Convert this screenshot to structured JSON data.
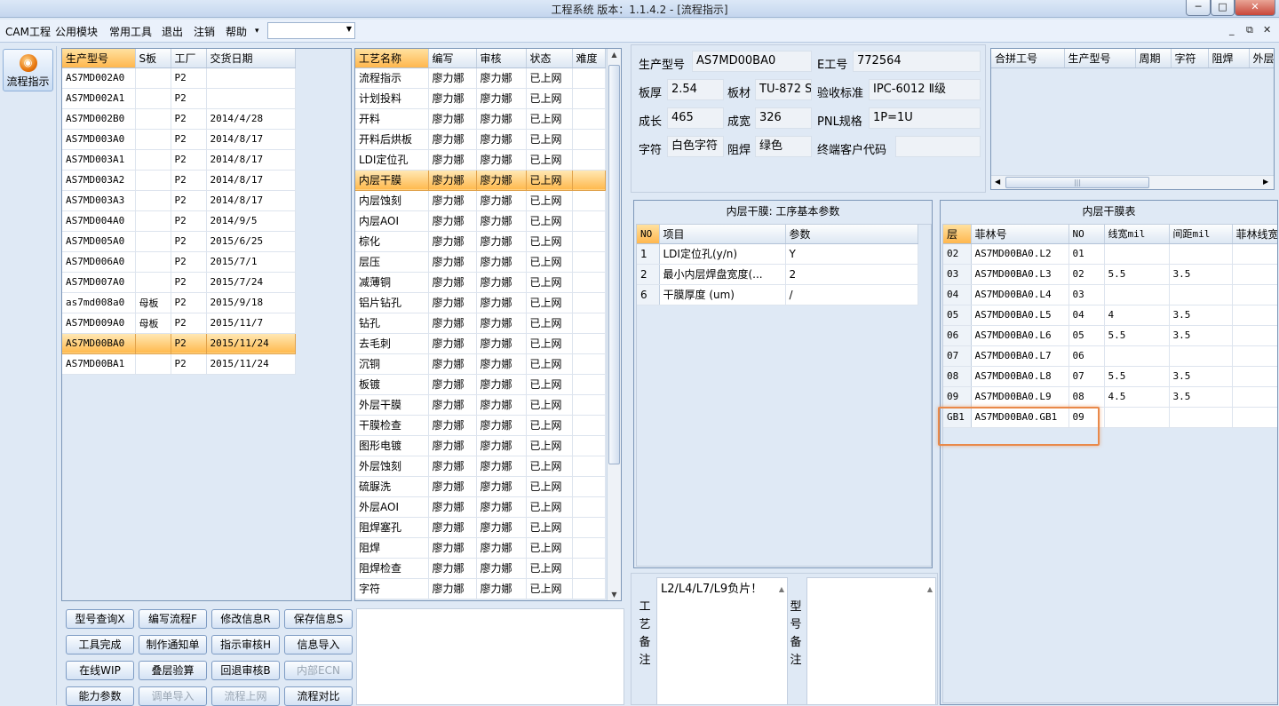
{
  "window": {
    "title": "工程系统   版本：1.1.4.2 - [流程指示]",
    "min": "─",
    "max": "□",
    "close": "✕"
  },
  "menu": {
    "items": [
      "CAM工程",
      "公用模块",
      "常用工具",
      "退出",
      "注销",
      "帮助"
    ],
    "help_arrow": "▾",
    "combo_value": "",
    "mdi": [
      "_",
      "⧉",
      "✕"
    ]
  },
  "nav": {
    "label": "流程指示"
  },
  "product_table": {
    "headers": [
      "生产型号",
      "S板",
      "工厂",
      "交货日期"
    ],
    "selected_index": 13,
    "rows": [
      [
        "AS7MD002A0",
        "",
        "P2",
        ""
      ],
      [
        "AS7MD002A1",
        "",
        "P2",
        ""
      ],
      [
        "AS7MD002B0",
        "",
        "P2",
        "2014/4/28"
      ],
      [
        "AS7MD003A0",
        "",
        "P2",
        "2014/8/17"
      ],
      [
        "AS7MD003A1",
        "",
        "P2",
        "2014/8/17"
      ],
      [
        "AS7MD003A2",
        "",
        "P2",
        "2014/8/17"
      ],
      [
        "AS7MD003A3",
        "",
        "P2",
        "2014/8/17"
      ],
      [
        "AS7MD004A0",
        "",
        "P2",
        "2014/9/5"
      ],
      [
        "AS7MD005A0",
        "",
        "P2",
        "2015/6/25"
      ],
      [
        "AS7MD006A0",
        "",
        "P2",
        "2015/7/1"
      ],
      [
        "AS7MD007A0",
        "",
        "P2",
        "2015/7/24"
      ],
      [
        "as7md008a0",
        "母板",
        "P2",
        "2015/9/18"
      ],
      [
        "AS7MD009A0",
        "母板",
        "P2",
        "2015/11/7"
      ],
      [
        "AS7MD00BA0",
        "",
        "P2",
        "2015/11/24"
      ],
      [
        "AS7MD00BA1",
        "",
        "P2",
        "2015/11/24"
      ]
    ]
  },
  "process_table": {
    "headers": [
      "工艺名称",
      "编写",
      "审核",
      "状态",
      "难度"
    ],
    "selected_index": 5,
    "rows": [
      [
        "流程指示",
        "廖力娜",
        "廖力娜",
        "已上网",
        ""
      ],
      [
        "计划投料",
        "廖力娜",
        "廖力娜",
        "已上网",
        ""
      ],
      [
        "开料",
        "廖力娜",
        "廖力娜",
        "已上网",
        ""
      ],
      [
        "开料后烘板",
        "廖力娜",
        "廖力娜",
        "已上网",
        ""
      ],
      [
        "LDI定位孔",
        "廖力娜",
        "廖力娜",
        "已上网",
        ""
      ],
      [
        "内层干膜",
        "廖力娜",
        "廖力娜",
        "已上网",
        ""
      ],
      [
        "内层蚀刻",
        "廖力娜",
        "廖力娜",
        "已上网",
        ""
      ],
      [
        "内层AOI",
        "廖力娜",
        "廖力娜",
        "已上网",
        ""
      ],
      [
        "棕化",
        "廖力娜",
        "廖力娜",
        "已上网",
        ""
      ],
      [
        "层压",
        "廖力娜",
        "廖力娜",
        "已上网",
        ""
      ],
      [
        "减薄铜",
        "廖力娜",
        "廖力娜",
        "已上网",
        ""
      ],
      [
        "铝片钻孔",
        "廖力娜",
        "廖力娜",
        "已上网",
        ""
      ],
      [
        "钻孔",
        "廖力娜",
        "廖力娜",
        "已上网",
        ""
      ],
      [
        "去毛刺",
        "廖力娜",
        "廖力娜",
        "已上网",
        ""
      ],
      [
        "沉铜",
        "廖力娜",
        "廖力娜",
        "已上网",
        ""
      ],
      [
        "板镀",
        "廖力娜",
        "廖力娜",
        "已上网",
        ""
      ],
      [
        "外层干膜",
        "廖力娜",
        "廖力娜",
        "已上网",
        ""
      ],
      [
        "干膜检查",
        "廖力娜",
        "廖力娜",
        "已上网",
        ""
      ],
      [
        "图形电镀",
        "廖力娜",
        "廖力娜",
        "已上网",
        ""
      ],
      [
        "外层蚀刻",
        "廖力娜",
        "廖力娜",
        "已上网",
        ""
      ],
      [
        "硫脲洗",
        "廖力娜",
        "廖力娜",
        "已上网",
        ""
      ],
      [
        "外层AOI",
        "廖力娜",
        "廖力娜",
        "已上网",
        ""
      ],
      [
        "阻焊塞孔",
        "廖力娜",
        "廖力娜",
        "已上网",
        ""
      ],
      [
        "阻焊",
        "廖力娜",
        "廖力娜",
        "已上网",
        ""
      ],
      [
        "阻焊检查",
        "廖力娜",
        "廖力娜",
        "已上网",
        ""
      ],
      [
        "字符",
        "廖力娜",
        "廖力娜",
        "已上网",
        ""
      ]
    ]
  },
  "buttons": [
    {
      "label": "型号查询X",
      "enabled": true
    },
    {
      "label": "编写流程F",
      "enabled": true
    },
    {
      "label": "修改信息R",
      "enabled": true
    },
    {
      "label": "保存信息S",
      "enabled": true
    },
    {
      "label": "工具完成",
      "enabled": true
    },
    {
      "label": "制作通知单",
      "enabled": true
    },
    {
      "label": "指示审核H",
      "enabled": true
    },
    {
      "label": "信息导入",
      "enabled": true
    },
    {
      "label": "在线WIP",
      "enabled": true
    },
    {
      "label": "叠层验算",
      "enabled": true
    },
    {
      "label": "回退审核B",
      "enabled": true
    },
    {
      "label": "内部ECN",
      "enabled": false
    },
    {
      "label": "能力参数",
      "enabled": true
    },
    {
      "label": "调单导入",
      "enabled": false
    },
    {
      "label": "流程上网",
      "enabled": false
    },
    {
      "label": "流程对比",
      "enabled": true
    }
  ],
  "info": {
    "model_label": "生产型号",
    "model_value": "AS7MD00BA0",
    "eno_label": "E工号",
    "eno_value": "772564",
    "thickness_label": "板厚",
    "thickness_value": "2.54",
    "material_label": "板材",
    "material_value": "TU-872 S",
    "standard_label": "验收标准",
    "standard_value": "IPC-6012 Ⅱ级",
    "length_label": "成长",
    "length_value": "465",
    "width_label": "成宽",
    "width_value": "326",
    "pnl_label": "PNL规格",
    "pnl_value": "1P=1U",
    "char_label": "字符",
    "char_value": "白色字符",
    "mask_label": "阻焊",
    "mask_value": "绿色",
    "customer_label": "终端客户代码",
    "customer_value": ""
  },
  "merge_table": {
    "headers": [
      "合拼工号",
      "生产型号",
      "周期",
      "字符",
      "阻焊",
      "外层"
    ],
    "scroll_thumb": "|||"
  },
  "params": {
    "title": "内层干膜: 工序基本参数",
    "headers": [
      "NO",
      "项目",
      "参数"
    ],
    "rows": [
      [
        "1",
        "LDI定位孔(y/n)",
        "Y"
      ],
      [
        "2",
        "最小内层焊盘宽度(...",
        "2"
      ],
      [
        "6",
        "干膜厚度 (um)",
        "/"
      ]
    ]
  },
  "film_table": {
    "title": "内层干膜表",
    "headers": [
      "层",
      "菲林号",
      "NO",
      "线宽mil",
      "间距mil",
      "菲林线宽"
    ],
    "rows": [
      [
        "02",
        "AS7MD00BA0.L2",
        "01",
        "",
        "",
        ""
      ],
      [
        "03",
        "AS7MD00BA0.L3",
        "02",
        "5.5",
        "3.5",
        ""
      ],
      [
        "04",
        "AS7MD00BA0.L4",
        "03",
        "",
        "",
        ""
      ],
      [
        "05",
        "AS7MD00BA0.L5",
        "04",
        "4",
        "3.5",
        ""
      ],
      [
        "06",
        "AS7MD00BA0.L6",
        "05",
        "5.5",
        "3.5",
        ""
      ],
      [
        "07",
        "AS7MD00BA0.L7",
        "06",
        "",
        "",
        ""
      ],
      [
        "08",
        "AS7MD00BA0.L8",
        "07",
        "5.5",
        "3.5",
        ""
      ],
      [
        "09",
        "AS7MD00BA0.L9",
        "08",
        "4.5",
        "3.5",
        ""
      ],
      [
        "GB1",
        "AS7MD00BA0.GB1",
        "09",
        "",
        "",
        ""
      ]
    ]
  },
  "notes": {
    "process_label": "工艺备注",
    "process_text": "L2/L4/L7/L9负片！",
    "model_label": "型号备注",
    "model_text": ""
  }
}
